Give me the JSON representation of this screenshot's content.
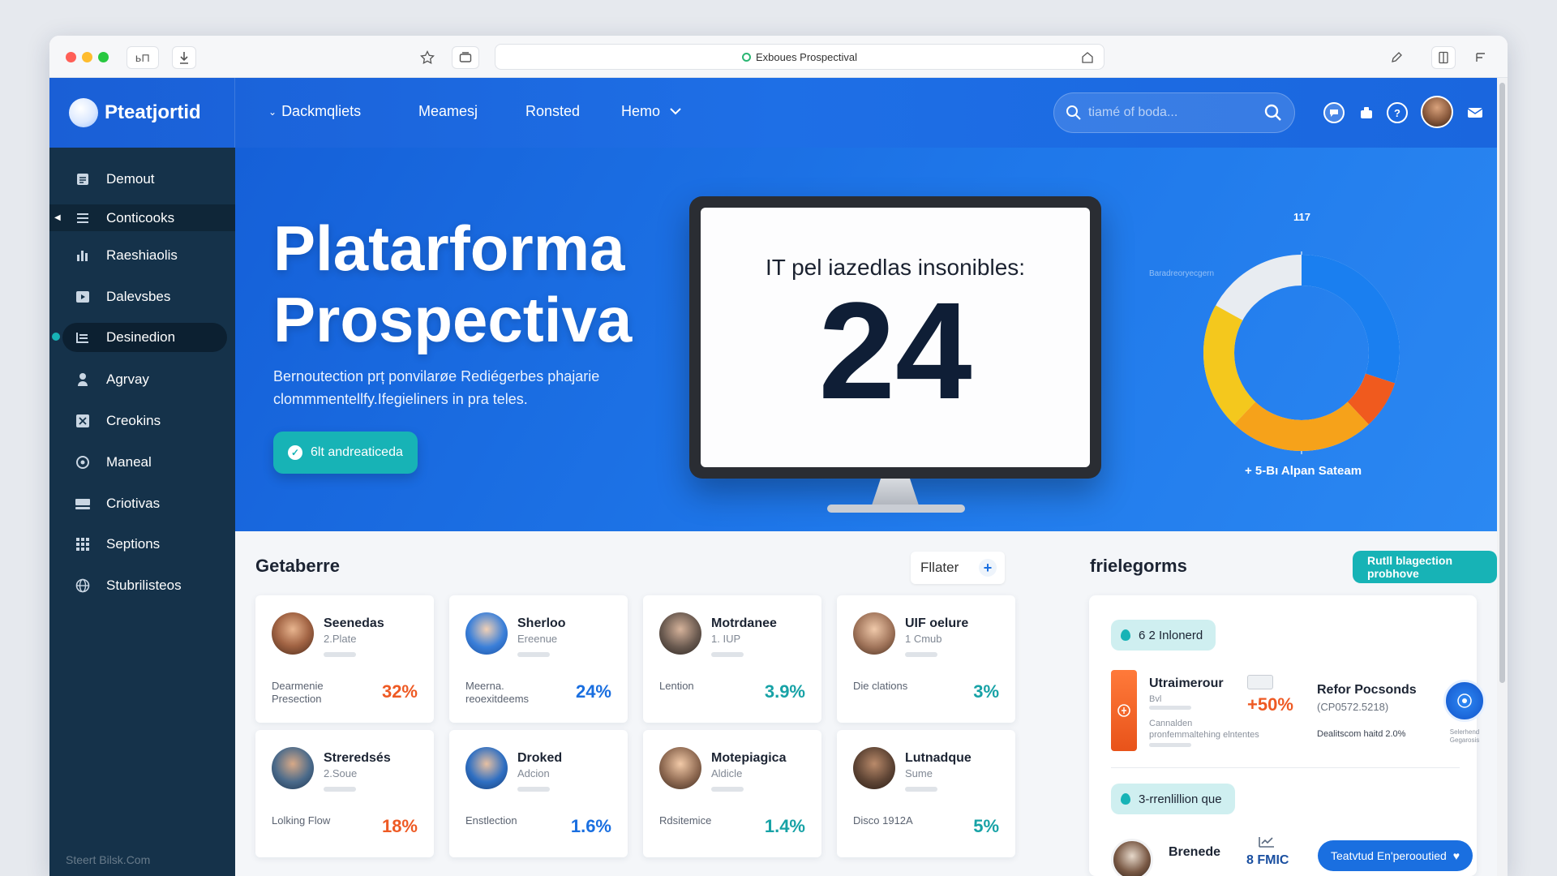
{
  "browser": {
    "url_title": "Exboues Prospectival",
    "left_btn": "ь⊓"
  },
  "brand": {
    "name": "Pteatjortid"
  },
  "topnav": {
    "items": [
      "Dackmqliets",
      "Meamesj",
      "Ronsted",
      "Hemo"
    ],
    "search_placeholder": "tiamé of boda..."
  },
  "sidebar": {
    "items": [
      {
        "label": "Demout",
        "icon": "document-icon"
      },
      {
        "label": "Conticooks",
        "icon": "list-icon"
      },
      {
        "label": "Raeshiaolis",
        "icon": "bar-chart-icon"
      },
      {
        "label": "Dalevsbes",
        "icon": "play-icon"
      },
      {
        "label": "Desinedion",
        "icon": "list-icon"
      },
      {
        "label": "Agrvay",
        "icon": "user-icon"
      },
      {
        "label": "Creokins",
        "icon": "close-box-icon"
      },
      {
        "label": "Maneal",
        "icon": "target-icon"
      },
      {
        "label": "Criotivas",
        "icon": "stack-icon"
      },
      {
        "label": "Septions",
        "icon": "grid-icon"
      },
      {
        "label": "Stubrilisteos",
        "icon": "globe-icon"
      }
    ],
    "footer": "Steert Bilsk.Com"
  },
  "hero": {
    "title_line1": "Platarforma",
    "title_line2": "Prospectiva",
    "subtitle": "Bernoutection prț ponvilarøe Rediégerbes phajarie clommmentellfy.Ifegieliners in pra teles.",
    "cta": "6lt andreaticeda",
    "monitor_label": "ΙΤ pel iazedlas insonibles:",
    "monitor_number": "24",
    "donut_top_label": "117",
    "donut_side_label": "Baradreoryecgern",
    "donut_bottom_label": "+ 5-Bı Alpan Sateam",
    "donut_colors": [
      "#1a7ff0",
      "#f05a1e",
      "#f6a21a",
      "#f4c81d",
      "#e8ecf1"
    ]
  },
  "getaberre": {
    "title": "Getaberre",
    "filter": "Fllater",
    "cards": [
      {
        "name": "Seenedas",
        "role": "2.Plate",
        "label": "Dearmenie Presection",
        "pct": "32%",
        "color": "#ee5a24"
      },
      {
        "name": "Sherloo",
        "role": "Ereenue",
        "label": "Meerna. reoexitdeems",
        "pct": "24%",
        "color": "#1a6fe0"
      },
      {
        "name": "Motrdanee",
        "role": "1. IUP",
        "label": "Lention",
        "pct": "3.9%",
        "color": "#17a2a6"
      },
      {
        "name": "UIF oelure",
        "role": "1 Cmub",
        "label": "Die clations",
        "pct": "3%",
        "color": "#17a2a6"
      },
      {
        "name": "Streredsés",
        "role": "2.Soue",
        "label": "Lolking Flow",
        "pct": "18%",
        "color": "#ee5a24"
      },
      {
        "name": "Droked",
        "role": "Adcion",
        "label": "Enstlection",
        "pct": "1.6%",
        "color": "#1a6fe0"
      },
      {
        "name": "Motepiagica",
        "role": "Aldicle",
        "label": "Rdsitemice",
        "pct": "1.4%",
        "color": "#17a2a6"
      },
      {
        "name": "Lutnadque",
        "role": "Sume",
        "label": "Disco 1912A",
        "pct": "5%",
        "color": "#17a2a6"
      }
    ]
  },
  "frielegorms": {
    "title": "frielegorms",
    "cta": "Rutll blagection probhove",
    "pill1": "6 2 Inlonerd",
    "item_title": "Utraimerour",
    "item_sub": "Bvl",
    "item_desc1": "Cannalden",
    "item_desc2": "pronfemmaltehing elntentes",
    "item_pct": "+50%",
    "refor_title": "Refor Pocsonds",
    "refor_code": "(CP0572.5218)",
    "refor_note": "Dealitscom haitd 2.0%",
    "refor_badge": "Selerhend Gegarosis",
    "pill2": "3-rrenlillion que",
    "bottom_name": "Brenede",
    "bottom_value": "8 FMIC",
    "bottom_btn": "Teatvtud En'perooutied"
  }
}
